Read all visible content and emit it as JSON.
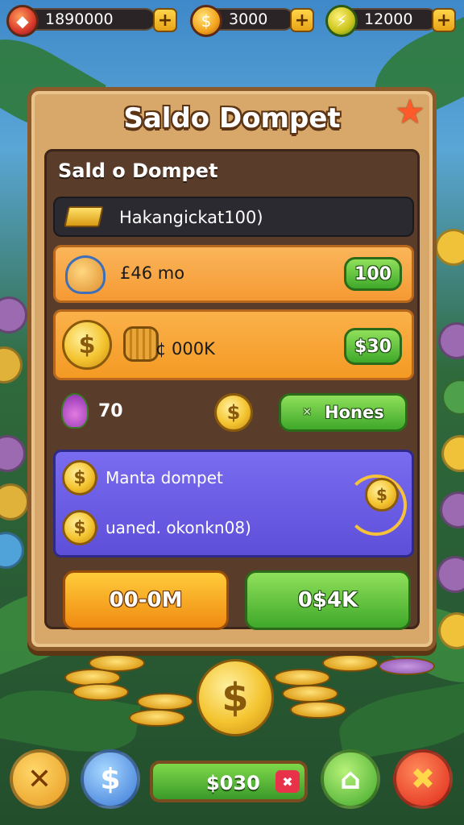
{
  "resources": [
    {
      "icon": "gem-icon",
      "value": "1890000",
      "plus": "+"
    },
    {
      "icon": "coin-icon",
      "value": "3000",
      "plus": "+"
    },
    {
      "icon": "lightning-icon",
      "value": "12000",
      "plus": "+"
    }
  ],
  "panel": {
    "title": "Saldo Dompet",
    "subtitle": "Sald  o  Dompet",
    "row1_label": "Hakangickat100)",
    "row2_label": "£46 mo",
    "row2_badge": "100",
    "row3_label": "¢ 000K",
    "row3_badge": "$30",
    "row4_value": "70",
    "row4_button": "Hones",
    "row4_button_prefix": "✕",
    "wallet_line1": "Manta dompet",
    "wallet_line2": "uaned. okonkn08)",
    "btn_left": "00-0M",
    "btn_right": "0$4K"
  },
  "bottom": {
    "balance": "$030",
    "balance_badge": "✖"
  },
  "colors": {
    "panel_wood": "#d8a86a",
    "row_orange": "#f9a846",
    "row_purple": "#6a5be0",
    "accent_green": "#3fa82a"
  }
}
